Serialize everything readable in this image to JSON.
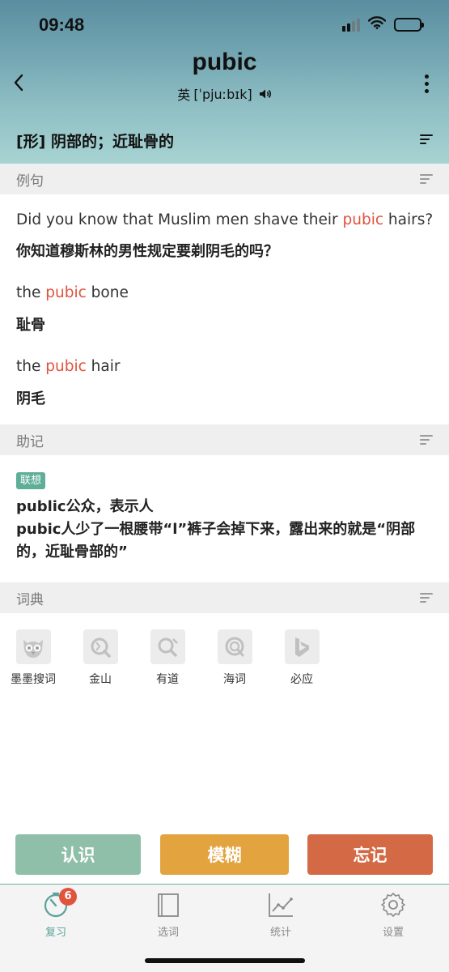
{
  "status": {
    "time": "09:48"
  },
  "header": {
    "word": "pubic",
    "accent": "英",
    "phonetic": "[ˈpjuːbɪk]",
    "definition": "[形] 阴部的；近耻骨的"
  },
  "sections": {
    "examples": "例句",
    "mnemonic": "助记",
    "dictionaries": "词典"
  },
  "examples": [
    {
      "before": "Did you know that Muslim men shave their ",
      "highlight": "pubic",
      "after": " hairs?",
      "translation": "你知道穆斯林的男性规定要剃阴毛的吗？"
    },
    {
      "before": "the ",
      "highlight": "pubic",
      "after": " bone",
      "translation": "耻骨"
    },
    {
      "before": "the ",
      "highlight": "pubic",
      "after": " hair",
      "translation": "阴毛"
    }
  ],
  "mnemonic": {
    "tag": "联想",
    "line1": "public公众，表示人",
    "line2": "pubic人少了一根腰带“l”裤子会掉下来，露出来的就是“阴部的，近耻骨部的”"
  },
  "dictionaries": [
    {
      "label": "墨墨搜词",
      "icon": "owl-icon"
    },
    {
      "label": "金山",
      "icon": "kingsoft-icon"
    },
    {
      "label": "有道",
      "icon": "youdao-icon"
    },
    {
      "label": "海词",
      "icon": "dict-cn-icon"
    },
    {
      "label": "必应",
      "icon": "bing-icon"
    }
  ],
  "actions": {
    "know": "认识",
    "vague": "模糊",
    "forget": "忘记"
  },
  "action_colors": {
    "know": "#8fbfa8",
    "vague": "#e3a33f",
    "forget": "#d36a45"
  },
  "tabs": [
    {
      "label": "复习",
      "badge": "6",
      "icon": "timer-icon"
    },
    {
      "label": "选词",
      "icon": "book-icon"
    },
    {
      "label": "统计",
      "icon": "chart-icon"
    },
    {
      "label": "设置",
      "icon": "gear-icon"
    }
  ],
  "colors": {
    "highlight": "#e0533d",
    "accent": "#59a39a"
  }
}
